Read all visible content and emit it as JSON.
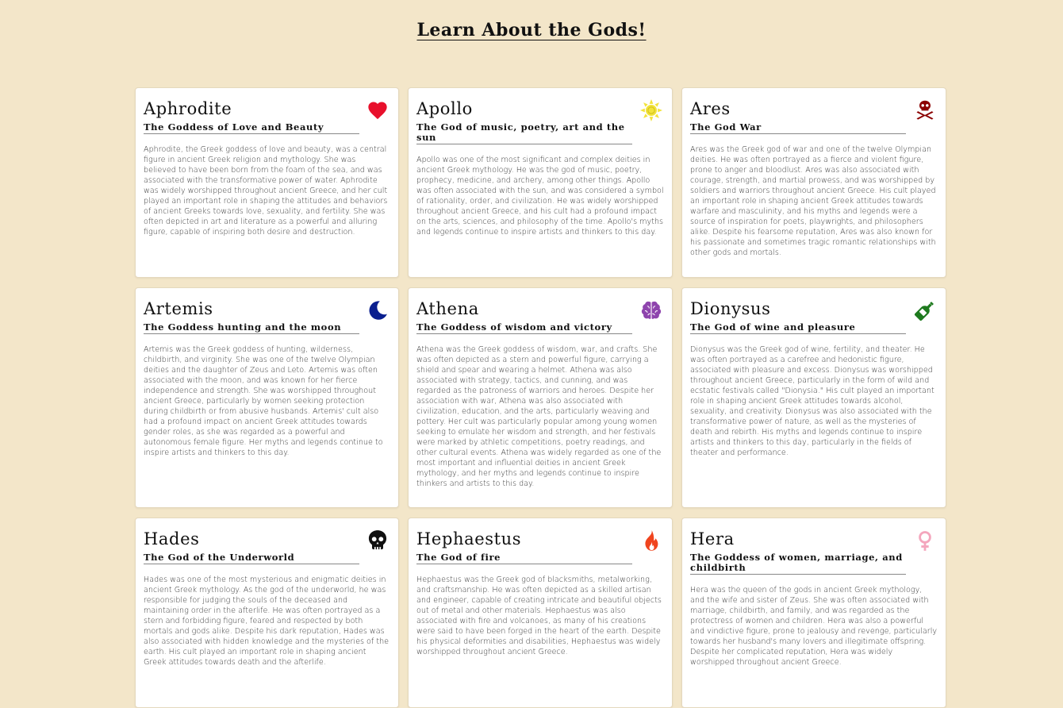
{
  "header": {
    "title": "Learn About the Gods!"
  },
  "gods": [
    {
      "name": "Aphrodite",
      "subtitle": "The Goddess of Love and Beauty",
      "icon": "heart-icon",
      "icon_color": "#e8102c",
      "description": "Aphrodite, the Greek goddess of love and beauty, was a central figure in ancient Greek religion and mythology. She was believed to have been born from the foam of the sea, and was associated with the transformative power of water. Aphrodite was widely worshipped throughout ancient Greece, and her cult played an important role in shaping the attitudes and behaviors of ancient Greeks towards love, sexuality, and fertility. She was often depicted in art and literature as a powerful and alluring figure, capable of inspiring both desire and destruction."
    },
    {
      "name": "Apollo",
      "subtitle": "The God of music, poetry, art and the sun",
      "icon": "sun-icon",
      "icon_color": "#f2e33a",
      "description": "Apollo was one of the most significant and complex deities in ancient Greek mythology. He was the god of music, poetry, prophecy, medicine, and archery, among other things. Apollo was often associated with the sun, and was considered a symbol of rationality, order, and civilization. He was widely worshipped throughout ancient Greece, and his cult had a profound impact on the arts, sciences, and philosophy of the time. Apollo's myths and legends continue to inspire artists and thinkers to this day."
    },
    {
      "name": "Ares",
      "subtitle": "The God War",
      "icon": "skull-crossbones-icon",
      "icon_color": "#8b0000",
      "description": "Ares was the Greek god of war and one of the twelve Olympian deities. He was often portrayed as a fierce and violent figure, prone to anger and bloodlust. Ares was also associated with courage, strength, and martial prowess, and was worshipped by soldiers and warriors throughout ancient Greece. His cult played an important role in shaping ancient Greek attitudes towards warfare and masculinity, and his myths and legends were a source of inspiration for poets, playwrights, and philosophers alike. Despite his fearsome reputation, Ares was also known for his passionate and sometimes tragic romantic relationships with other gods and mortals."
    },
    {
      "name": "Artemis",
      "subtitle": "The Goddess hunting and the moon",
      "icon": "moon-icon",
      "icon_color": "#0a1f8f",
      "description": "Artemis was the Greek goddess of hunting, wilderness, childbirth, and virginity. She was one of the twelve Olympian deities and the daughter of Zeus and Leto. Artemis was often associated with the moon, and was known for her fierce independence and strength. She was worshipped throughout ancient Greece, particularly by women seeking protection during childbirth or from abusive husbands. Artemis' cult also had a profound impact on ancient Greek attitudes towards gender roles, as she was regarded as a powerful and autonomous female figure. Her myths and legends continue to inspire artists and thinkers to this day."
    },
    {
      "name": "Athena",
      "subtitle": "The Goddess of wisdom and victory",
      "icon": "brain-icon",
      "icon_color": "#8e44ad",
      "description": "Athena was the Greek goddess of wisdom, war, and crafts. She was often depicted as a stern and powerful figure, carrying a shield and spear and wearing a helmet. Athena was also associated with strategy, tactics, and cunning, and was regarded as the patroness of warriors and heroes. Despite her association with war, Athena was also associated with civilization, education, and the arts, particularly weaving and pottery. Her cult was particularly popular among young women seeking to emulate her wisdom and strength, and her festivals were marked by athletic competitions, poetry readings, and other cultural events. Athena was widely regarded as one of the most important and influential deities in ancient Greek mythology, and her myths and legends continue to inspire thinkers and artists to this day."
    },
    {
      "name": "Dionysus",
      "subtitle": "The God of wine and pleasure",
      "icon": "wine-bottle-icon",
      "icon_color": "#1e7a1e",
      "description": "Dionysus was the Greek god of wine, fertility, and theater. He was often portrayed as a carefree and hedonistic figure, associated with pleasure and excess. Dionysus was worshipped throughout ancient Greece, particularly in the form of wild and ecstatic festivals called \"Dionysia.\" His cult played an important role in shaping ancient Greek attitudes towards alcohol, sexuality, and creativity. Dionysus was also associated with the transformative power of nature, as well as the mysteries of death and rebirth. His myths and legends continue to inspire artists and thinkers to this day, particularly in the fields of theater and performance."
    },
    {
      "name": "Hades",
      "subtitle": "The God of the Underworld",
      "icon": "skull-icon",
      "icon_color": "#111111",
      "description": "Hades was one of the most mysterious and enigmatic deities in ancient Greek mythology. As the god of the underworld, he was responsible for judging the souls of the deceased and maintaining order in the afterlife. He was often portrayed as a stern and forbidding figure, feared and respected by both mortals and gods alike. Despite his dark reputation, Hades was also associated with hidden knowledge and the mysteries of the earth. His cult played an important role in shaping ancient Greek attitudes towards death and the afterlife."
    },
    {
      "name": "Hephaestus",
      "subtitle": "The God of fire",
      "icon": "fire-icon",
      "icon_color": "#f0441e",
      "description": "Hephaestus was the Greek god of blacksmiths, metalworking, and craftsmanship. He was often depicted as a skilled artisan and engineer, capable of creating intricate and beautiful objects out of metal and other materials. Hephaestus was also associated with fire and volcanoes, as many of his creations were said to have been forged in the heart of the earth. Despite his physical deformities and disabilities, Hephaestus was widely worshipped throughout ancient Greece."
    },
    {
      "name": "Hera",
      "subtitle": "The Goddess of women, marriage, and childbirth",
      "icon": "venus-icon",
      "icon_color": "#f4a6bd",
      "description": "Hera was the queen of the gods in ancient Greek mythology, and the wife and sister of Zeus. She was often associated with marriage, childbirth, and family, and was regarded as the protectress of women and children. Hera was also a powerful and vindictive figure, prone to jealousy and revenge, particularly towards her husband's many lovers and illegitimate offspring. Despite her complicated reputation, Hera was widely worshipped throughout ancient Greece."
    }
  ]
}
